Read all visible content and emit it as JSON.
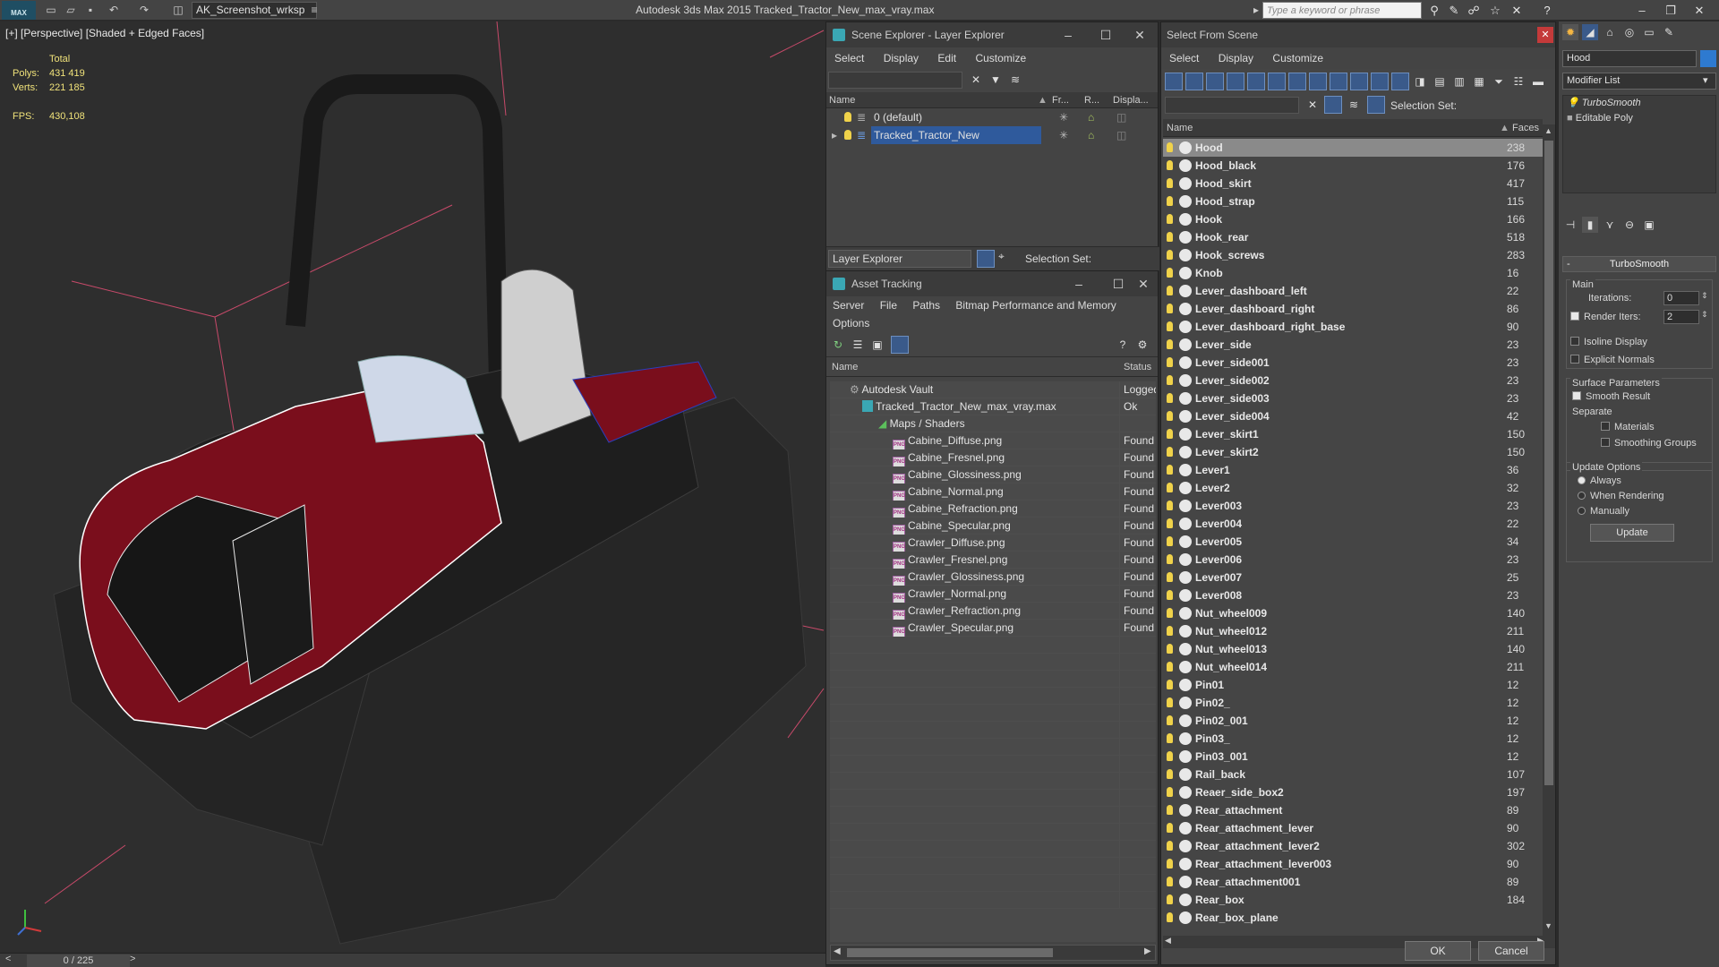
{
  "titlebar": {
    "logo": "MAX",
    "workspace": "AK_Screenshot_wrksp",
    "app_title": "Autodesk 3ds Max  2015     Tracked_Tractor_New_max_vray.max",
    "search_placeholder": "Type a keyword or phrase"
  },
  "viewport": {
    "label": "[+] [Perspective] [Shaded + Edged Faces]",
    "stats": {
      "total_label": "Total",
      "polys_label": "Polys:",
      "polys_value": "431 419",
      "verts_label": "Verts:",
      "verts_value": "221 185",
      "fps_label": "FPS:",
      "fps_value": "430,108"
    },
    "frame_counter": "0 / 225",
    "prev": "<",
    "next": ">"
  },
  "scene_explorer": {
    "title": "Scene Explorer - Layer Explorer",
    "menus": [
      "Select",
      "Display",
      "Edit",
      "Customize"
    ],
    "columns": {
      "name": "Name",
      "freeze": "Fr...",
      "render": "R...",
      "display": "Displa..."
    },
    "layers": [
      {
        "name": "0 (default)",
        "selected": false
      },
      {
        "name": "Tracked_Tractor_New",
        "selected": true
      }
    ],
    "footer_dropdown": "Layer Explorer",
    "selection_set_label": "Selection Set:"
  },
  "asset_tracking": {
    "title": "Asset Tracking",
    "menus": [
      "Server",
      "File",
      "Paths",
      "Bitmap Performance and Memory"
    ],
    "menus2": [
      "Options"
    ],
    "columns": {
      "name": "Name",
      "status": "Status"
    },
    "vault": {
      "name": "Autodesk Vault",
      "status": "Logged"
    },
    "file": {
      "name": "Tracked_Tractor_New_max_vray.max",
      "status": "Ok"
    },
    "folder": {
      "name": "Maps / Shaders",
      "status": ""
    },
    "png_tag": "PNG",
    "maps": [
      {
        "name": "Cabine_Diffuse.png",
        "status": "Found"
      },
      {
        "name": "Cabine_Fresnel.png",
        "status": "Found"
      },
      {
        "name": "Cabine_Glossiness.png",
        "status": "Found"
      },
      {
        "name": "Cabine_Normal.png",
        "status": "Found"
      },
      {
        "name": "Cabine_Refraction.png",
        "status": "Found"
      },
      {
        "name": "Cabine_Specular.png",
        "status": "Found"
      },
      {
        "name": "Crawler_Diffuse.png",
        "status": "Found"
      },
      {
        "name": "Crawler_Fresnel.png",
        "status": "Found"
      },
      {
        "name": "Crawler_Glossiness.png",
        "status": "Found"
      },
      {
        "name": "Crawler_Normal.png",
        "status": "Found"
      },
      {
        "name": "Crawler_Refraction.png",
        "status": "Found"
      },
      {
        "name": "Crawler_Specular.png",
        "status": "Found"
      }
    ]
  },
  "select_from_scene": {
    "title": "Select From Scene",
    "menus": [
      "Select",
      "Display",
      "Customize"
    ],
    "selection_set_label": "Selection Set:",
    "columns": {
      "name": "Name",
      "faces": "Faces"
    },
    "rows": [
      {
        "name": "Hood",
        "faces": "238",
        "selected": true
      },
      {
        "name": "Hood_black",
        "faces": "176"
      },
      {
        "name": "Hood_skirt",
        "faces": "417"
      },
      {
        "name": "Hood_strap",
        "faces": "115"
      },
      {
        "name": "Hook",
        "faces": "166"
      },
      {
        "name": "Hook_rear",
        "faces": "518"
      },
      {
        "name": "Hook_screws",
        "faces": "283"
      },
      {
        "name": "Knob",
        "faces": "16"
      },
      {
        "name": "Lever_dashboard_left",
        "faces": "22"
      },
      {
        "name": "Lever_dashboard_right",
        "faces": "86"
      },
      {
        "name": "Lever_dashboard_right_base",
        "faces": "90"
      },
      {
        "name": "Lever_side",
        "faces": "23"
      },
      {
        "name": "Lever_side001",
        "faces": "23"
      },
      {
        "name": "Lever_side002",
        "faces": "23"
      },
      {
        "name": "Lever_side003",
        "faces": "23"
      },
      {
        "name": "Lever_side004",
        "faces": "42"
      },
      {
        "name": "Lever_skirt1",
        "faces": "150"
      },
      {
        "name": "Lever_skirt2",
        "faces": "150"
      },
      {
        "name": "Lever1",
        "faces": "36"
      },
      {
        "name": "Lever2",
        "faces": "32"
      },
      {
        "name": "Lever003",
        "faces": "23"
      },
      {
        "name": "Lever004",
        "faces": "22"
      },
      {
        "name": "Lever005",
        "faces": "34"
      },
      {
        "name": "Lever006",
        "faces": "23"
      },
      {
        "name": "Lever007",
        "faces": "25"
      },
      {
        "name": "Lever008",
        "faces": "23"
      },
      {
        "name": "Nut_wheel009",
        "faces": "140"
      },
      {
        "name": "Nut_wheel012",
        "faces": "211"
      },
      {
        "name": "Nut_wheel013",
        "faces": "140"
      },
      {
        "name": "Nut_wheel014",
        "faces": "211"
      },
      {
        "name": "Pin01",
        "faces": "12"
      },
      {
        "name": "Pin02_",
        "faces": "12"
      },
      {
        "name": "Pin02_001",
        "faces": "12"
      },
      {
        "name": "Pin03_",
        "faces": "12"
      },
      {
        "name": "Pin03_001",
        "faces": "12"
      },
      {
        "name": "Rail_back",
        "faces": "107"
      },
      {
        "name": "Reaer_side_box2",
        "faces": "197"
      },
      {
        "name": "Rear_attachment",
        "faces": "89"
      },
      {
        "name": "Rear_attachment_lever",
        "faces": "90"
      },
      {
        "name": "Rear_attachment_lever2",
        "faces": "302"
      },
      {
        "name": "Rear_attachment_lever003",
        "faces": "90"
      },
      {
        "name": "Rear_attachment001",
        "faces": "89"
      },
      {
        "name": "Rear_box",
        "faces": "184"
      },
      {
        "name": "Rear_box_plane",
        "faces": ""
      }
    ],
    "ok_label": "OK",
    "cancel_label": "Cancel"
  },
  "command_panel": {
    "object_name": "Hood",
    "modifier_list": "Modifier List",
    "stack": [
      "TurboSmooth",
      "Editable Poly"
    ],
    "rollout_title": "TurboSmooth",
    "main_label": "Main",
    "iterations_label": "Iterations:",
    "iterations_value": "0",
    "render_iters_label": "Render Iters:",
    "render_iters_value": "2",
    "isoline_label": "Isoline Display",
    "explicit_normals_label": "Explicit Normals",
    "surface_params_label": "Surface Parameters",
    "smooth_result_label": "Smooth Result",
    "separate_label": "Separate",
    "materials_label": "Materials",
    "smoothing_groups_label": "Smoothing Groups",
    "update_options_label": "Update Options",
    "always_label": "Always",
    "when_rendering_label": "When Rendering",
    "manually_label": "Manually",
    "update_button": "Update"
  },
  "colors": {
    "selection_blue": "#2f5a9c",
    "stats_yellow": "#f0e27a",
    "accent_teal": "#3aa7b4"
  }
}
